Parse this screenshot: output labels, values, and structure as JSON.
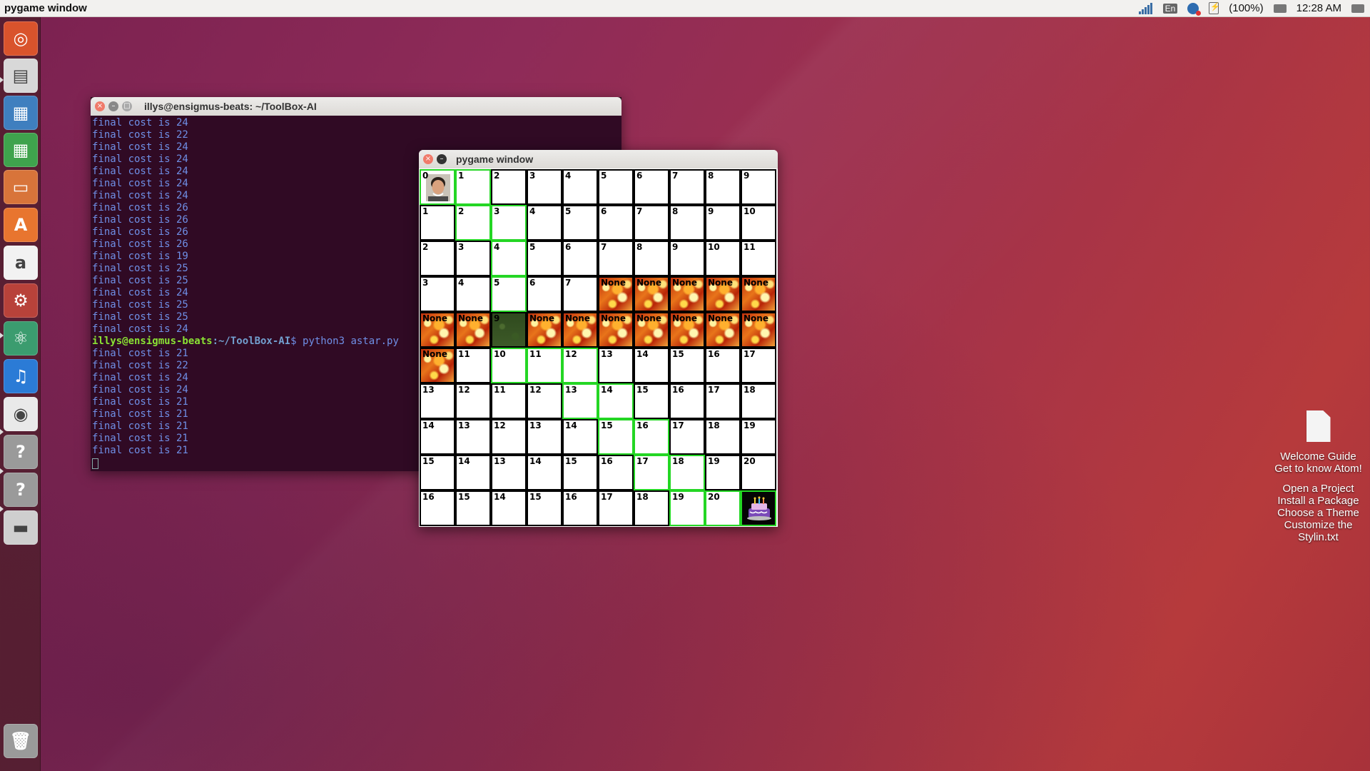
{
  "top_panel": {
    "title": "pygame window",
    "lang": "En",
    "battery": "(100%)",
    "clock": "12:28 AM"
  },
  "launcher": {
    "items": [
      {
        "name": "ubuntu-dash-icon",
        "glyph": "◎"
      },
      {
        "name": "files-icon",
        "glyph": "▤"
      },
      {
        "name": "libreoffice-writer-icon",
        "glyph": "▦"
      },
      {
        "name": "libreoffice-calc-icon",
        "glyph": "▦"
      },
      {
        "name": "libreoffice-impress-icon",
        "glyph": "▭"
      },
      {
        "name": "software-center-icon",
        "glyph": "A"
      },
      {
        "name": "amazon-icon",
        "glyph": "a"
      },
      {
        "name": "system-settings-icon",
        "glyph": "⚙"
      },
      {
        "name": "atom-editor-icon",
        "glyph": "⚛"
      },
      {
        "name": "music-player-icon",
        "glyph": "♫"
      },
      {
        "name": "chrome-browser-icon",
        "glyph": "◉"
      },
      {
        "name": "unknown-app-icon",
        "glyph": "?"
      },
      {
        "name": "unknown-app-icon",
        "glyph": "?"
      },
      {
        "name": "disk-drive-icon",
        "glyph": "▬"
      },
      {
        "name": "trash-icon",
        "glyph": "🗑"
      }
    ]
  },
  "terminal": {
    "title": "illys@ensigmus-beats: ~/ToolBox-AI",
    "lines_before": [
      "final cost is 24",
      "final cost is 22",
      "final cost is 24",
      "final cost is 24",
      "final cost is 24",
      "final cost is 24",
      "final cost is 24",
      "final cost is 26",
      "final cost is 26",
      "final cost is 26",
      "final cost is 26",
      "final cost is 19",
      "final cost is 25",
      "final cost is 25",
      "final cost is 24",
      "final cost is 25",
      "final cost is 25",
      "final cost is 24"
    ],
    "prompt_user": "illys@ensigmus-beats",
    "prompt_path": ":~/ToolBox-AI",
    "prompt_cmd": "$ python3 astar.py",
    "lines_after": [
      "final cost is 21",
      "final cost is 22",
      "final cost is 24",
      "final cost is 24",
      "final cost is 21",
      "final cost is 21",
      "final cost is 21",
      "final cost is 21",
      "final cost is 21"
    ]
  },
  "pygame": {
    "title": "pygame window",
    "grid": [
      [
        {
          "l": "0",
          "t": "start"
        },
        {
          "l": "1",
          "t": "path"
        },
        {
          "l": "2",
          "t": "normal"
        },
        {
          "l": "3",
          "t": "normal"
        },
        {
          "l": "4",
          "t": "normal"
        },
        {
          "l": "5",
          "t": "normal"
        },
        {
          "l": "6",
          "t": "normal"
        },
        {
          "l": "7",
          "t": "normal"
        },
        {
          "l": "8",
          "t": "normal"
        },
        {
          "l": "9",
          "t": "normal"
        }
      ],
      [
        {
          "l": "1",
          "t": "normal"
        },
        {
          "l": "2",
          "t": "path"
        },
        {
          "l": "3",
          "t": "path"
        },
        {
          "l": "4",
          "t": "normal"
        },
        {
          "l": "5",
          "t": "normal"
        },
        {
          "l": "6",
          "t": "normal"
        },
        {
          "l": "7",
          "t": "normal"
        },
        {
          "l": "8",
          "t": "normal"
        },
        {
          "l": "9",
          "t": "normal"
        },
        {
          "l": "10",
          "t": "normal"
        }
      ],
      [
        {
          "l": "2",
          "t": "normal"
        },
        {
          "l": "3",
          "t": "normal"
        },
        {
          "l": "4",
          "t": "path"
        },
        {
          "l": "5",
          "t": "normal"
        },
        {
          "l": "6",
          "t": "normal"
        },
        {
          "l": "7",
          "t": "normal"
        },
        {
          "l": "8",
          "t": "normal"
        },
        {
          "l": "9",
          "t": "normal"
        },
        {
          "l": "10",
          "t": "normal"
        },
        {
          "l": "11",
          "t": "normal"
        }
      ],
      [
        {
          "l": "3",
          "t": "normal"
        },
        {
          "l": "4",
          "t": "normal"
        },
        {
          "l": "5",
          "t": "path"
        },
        {
          "l": "6",
          "t": "normal"
        },
        {
          "l": "7",
          "t": "normal"
        },
        {
          "l": "None",
          "t": "fire"
        },
        {
          "l": "None",
          "t": "fire"
        },
        {
          "l": "None",
          "t": "fire"
        },
        {
          "l": "None",
          "t": "fire"
        },
        {
          "l": "None",
          "t": "fire"
        }
      ],
      [
        {
          "l": "None",
          "t": "fire"
        },
        {
          "l": "None",
          "t": "fire"
        },
        {
          "l": "9",
          "t": "grass"
        },
        {
          "l": "None",
          "t": "fire"
        },
        {
          "l": "None",
          "t": "fire"
        },
        {
          "l": "None",
          "t": "fire"
        },
        {
          "l": "None",
          "t": "fire"
        },
        {
          "l": "None",
          "t": "fire"
        },
        {
          "l": "None",
          "t": "fire"
        },
        {
          "l": "None",
          "t": "fire"
        }
      ],
      [
        {
          "l": "None",
          "t": "fire"
        },
        {
          "l": "11",
          "t": "normal"
        },
        {
          "l": "10",
          "t": "path"
        },
        {
          "l": "11",
          "t": "path"
        },
        {
          "l": "12",
          "t": "path"
        },
        {
          "l": "13",
          "t": "normal"
        },
        {
          "l": "14",
          "t": "normal"
        },
        {
          "l": "15",
          "t": "normal"
        },
        {
          "l": "16",
          "t": "normal"
        },
        {
          "l": "17",
          "t": "normal"
        }
      ],
      [
        {
          "l": "13",
          "t": "normal"
        },
        {
          "l": "12",
          "t": "normal"
        },
        {
          "l": "11",
          "t": "normal"
        },
        {
          "l": "12",
          "t": "normal"
        },
        {
          "l": "13",
          "t": "path"
        },
        {
          "l": "14",
          "t": "path"
        },
        {
          "l": "15",
          "t": "normal"
        },
        {
          "l": "16",
          "t": "normal"
        },
        {
          "l": "17",
          "t": "normal"
        },
        {
          "l": "18",
          "t": "normal"
        }
      ],
      [
        {
          "l": "14",
          "t": "normal"
        },
        {
          "l": "13",
          "t": "normal"
        },
        {
          "l": "12",
          "t": "normal"
        },
        {
          "l": "13",
          "t": "normal"
        },
        {
          "l": "14",
          "t": "normal"
        },
        {
          "l": "15",
          "t": "path"
        },
        {
          "l": "16",
          "t": "path"
        },
        {
          "l": "17",
          "t": "normal"
        },
        {
          "l": "18",
          "t": "normal"
        },
        {
          "l": "19",
          "t": "normal"
        }
      ],
      [
        {
          "l": "15",
          "t": "normal"
        },
        {
          "l": "14",
          "t": "normal"
        },
        {
          "l": "13",
          "t": "normal"
        },
        {
          "l": "14",
          "t": "normal"
        },
        {
          "l": "15",
          "t": "normal"
        },
        {
          "l": "16",
          "t": "normal"
        },
        {
          "l": "17",
          "t": "path"
        },
        {
          "l": "18",
          "t": "path"
        },
        {
          "l": "19",
          "t": "normal"
        },
        {
          "l": "20",
          "t": "normal"
        }
      ],
      [
        {
          "l": "16",
          "t": "normal"
        },
        {
          "l": "15",
          "t": "normal"
        },
        {
          "l": "14",
          "t": "normal"
        },
        {
          "l": "15",
          "t": "normal"
        },
        {
          "l": "16",
          "t": "normal"
        },
        {
          "l": "17",
          "t": "normal"
        },
        {
          "l": "18",
          "t": "normal"
        },
        {
          "l": "19",
          "t": "path"
        },
        {
          "l": "20",
          "t": "path"
        },
        {
          "l": "",
          "t": "goal"
        }
      ]
    ]
  },
  "desktop_file": {
    "line1": "Welcome Guide",
    "line2": "Get to know Atom!",
    "line3": "Open a Project",
    "line4": "Install a Package",
    "line5": "Choose a Theme",
    "line6": "Customize the",
    "line7": "Stylin.txt"
  }
}
